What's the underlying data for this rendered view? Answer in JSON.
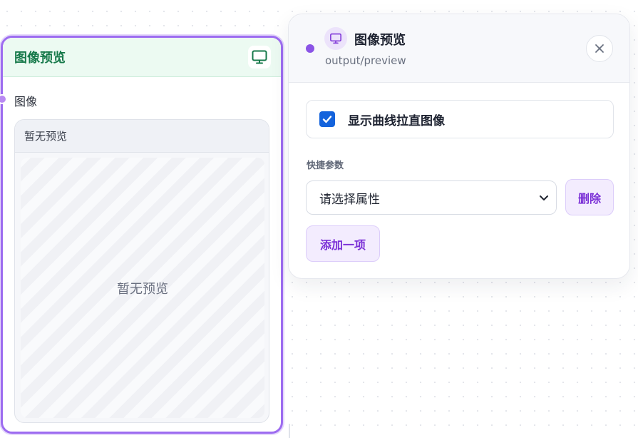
{
  "node": {
    "title": "图像预览",
    "header_icon": "monitor-icon",
    "input_label": "图像",
    "preview_header": "暂无预览",
    "preview_placeholder": "暂无预览"
  },
  "panel": {
    "icon": "monitor-icon",
    "title": "图像预览",
    "subtitle": "output/preview",
    "close_icon": "close-icon",
    "checkbox": {
      "label": "显示曲线拉直图像",
      "checked": true
    },
    "quick_params": {
      "label": "快捷参数",
      "select_value": "请选择属性",
      "delete_label": "删除",
      "add_label": "添加一项"
    }
  },
  "colors": {
    "accent": "#9d6cf0",
    "node_header_bg": "#ecfaf2",
    "node_title": "#16794a",
    "checkbox": "#1463dc",
    "button_text": "#7a2fd6"
  }
}
